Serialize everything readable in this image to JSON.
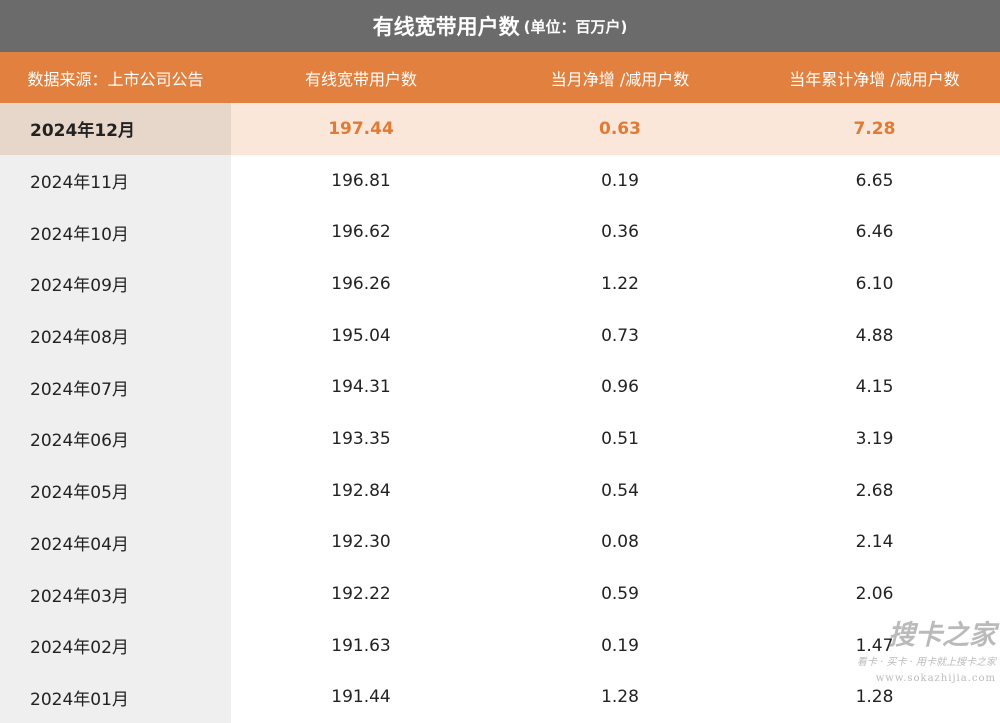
{
  "title": {
    "main": "有线宽带用户数",
    "unit": "(单位：百万户)"
  },
  "header": [
    "数据来源：上市公司公告",
    "有线宽带用户数",
    "当月净增 /减用户数",
    "当年累计净增 /减用户数"
  ],
  "colors": {
    "title_bg": "#6b6b6b",
    "header_bg": "#e2813f",
    "highlight_text": "#e07a35",
    "highlight_bg": "#fbe7da"
  },
  "watermark": {
    "logo": "搜卡之家",
    "slogan": "看卡 · 买卡 · 用卡就上搜卡之家",
    "url": "www.sokazhijia.com"
  },
  "chart_data": {
    "type": "table",
    "columns": [
      "数据来源：上市公司公告",
      "有线宽带用户数",
      "当月净增 /减用户数",
      "当年累计净增 /减用户数"
    ],
    "highlighted_row": 0,
    "rows": [
      [
        "2024年12月",
        "197.44",
        "0.63",
        "7.28"
      ],
      [
        "2024年11月",
        "196.81",
        "0.19",
        "6.65"
      ],
      [
        "2024年10月",
        "196.62",
        "0.36",
        "6.46"
      ],
      [
        "2024年09月",
        "196.26",
        "1.22",
        "6.10"
      ],
      [
        "2024年08月",
        "195.04",
        "0.73",
        "4.88"
      ],
      [
        "2024年07月",
        "194.31",
        "0.96",
        "4.15"
      ],
      [
        "2024年06月",
        "193.35",
        "0.51",
        "3.19"
      ],
      [
        "2024年05月",
        "192.84",
        "0.54",
        "2.68"
      ],
      [
        "2024年04月",
        "192.30",
        "0.08",
        "2.14"
      ],
      [
        "2024年03月",
        "192.22",
        "0.59",
        "2.06"
      ],
      [
        "2024年02月",
        "191.63",
        "0.19",
        "1.47"
      ],
      [
        "2024年01月",
        "191.44",
        "1.28",
        "1.28"
      ]
    ]
  }
}
